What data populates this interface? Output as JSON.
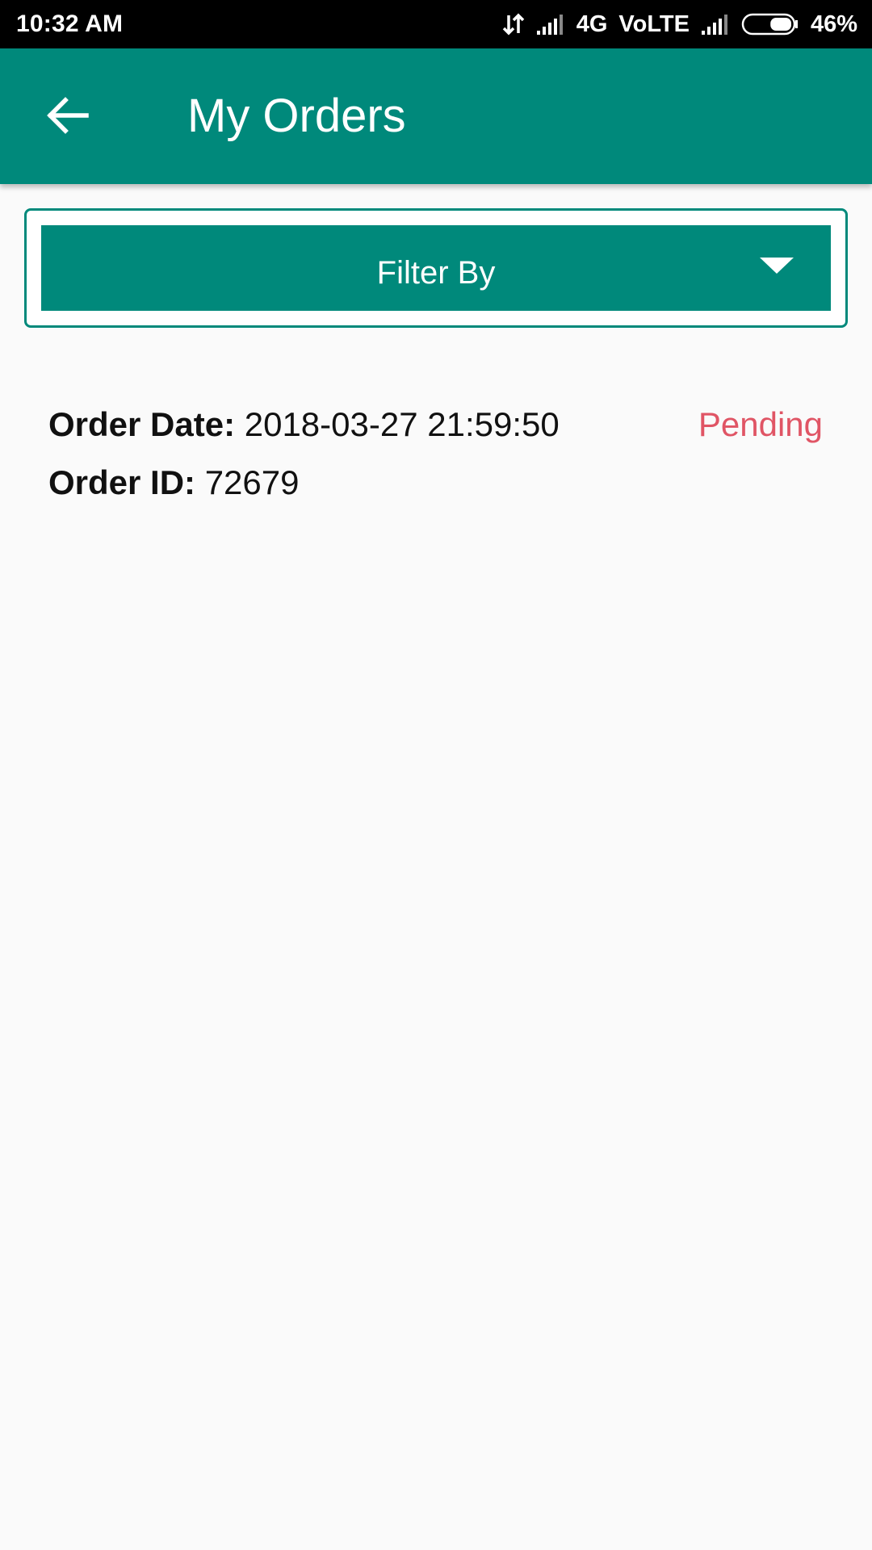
{
  "status_bar": {
    "time": "10:32 AM",
    "network": "4G",
    "volte": "VoLTE",
    "battery": "46%",
    "battery_level": 0.46,
    "icons": [
      "data-transfer-icon",
      "signal-icon",
      "signal-icon",
      "battery-icon"
    ]
  },
  "app_bar": {
    "title": "My Orders",
    "back_icon": "arrow-left-icon",
    "color": "#00897b"
  },
  "filter": {
    "label": "Filter By",
    "icon": "triangle-down-icon"
  },
  "orders": [
    {
      "date_key": "Order Date:",
      "date_value": "2018-03-27 21:59:50",
      "id_key": "Order ID:",
      "id_value": "72679",
      "status": "Pending",
      "status_color": "#e05565"
    }
  ]
}
